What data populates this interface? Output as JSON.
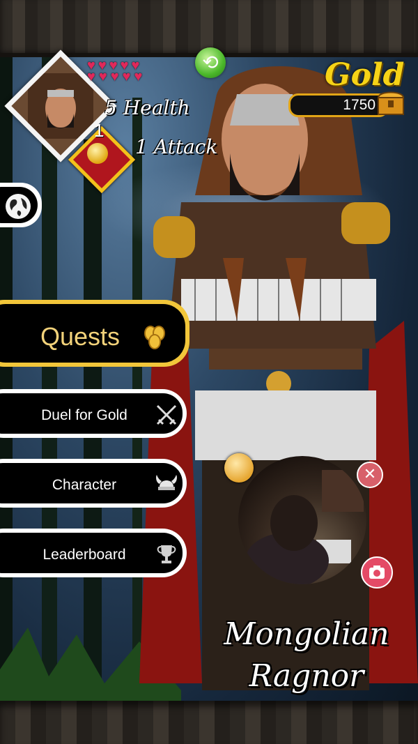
{
  "player": {
    "health_label": "5 Health",
    "attack_label": "1 Attack",
    "attack_level": "1",
    "hearts_full": 5,
    "hearts_empty": 5
  },
  "gold": {
    "title": "Gold",
    "amount": "1750"
  },
  "menu": {
    "quests": "Quests",
    "duel": "Duel for Gold",
    "character": "Character",
    "leaderboard": "Leaderboard"
  },
  "character_name": {
    "line1": "Mongolian",
    "line2": "Ragnor"
  },
  "icons": {
    "refresh": "refresh-icon",
    "globe": "globe-icon",
    "coins": "coins-icon",
    "swords": "crossed-swords-icon",
    "helmet": "viking-helmet-icon",
    "trophy": "trophy-icon",
    "chest": "treasure-chest-icon",
    "close": "close-icon",
    "camera": "camera-icon"
  },
  "colors": {
    "gold_accent": "#f2c63a",
    "heart": "#e0285a",
    "refresh_green": "#4bb82a",
    "close_red": "#d8606a",
    "camera_pink": "#e44a66"
  }
}
